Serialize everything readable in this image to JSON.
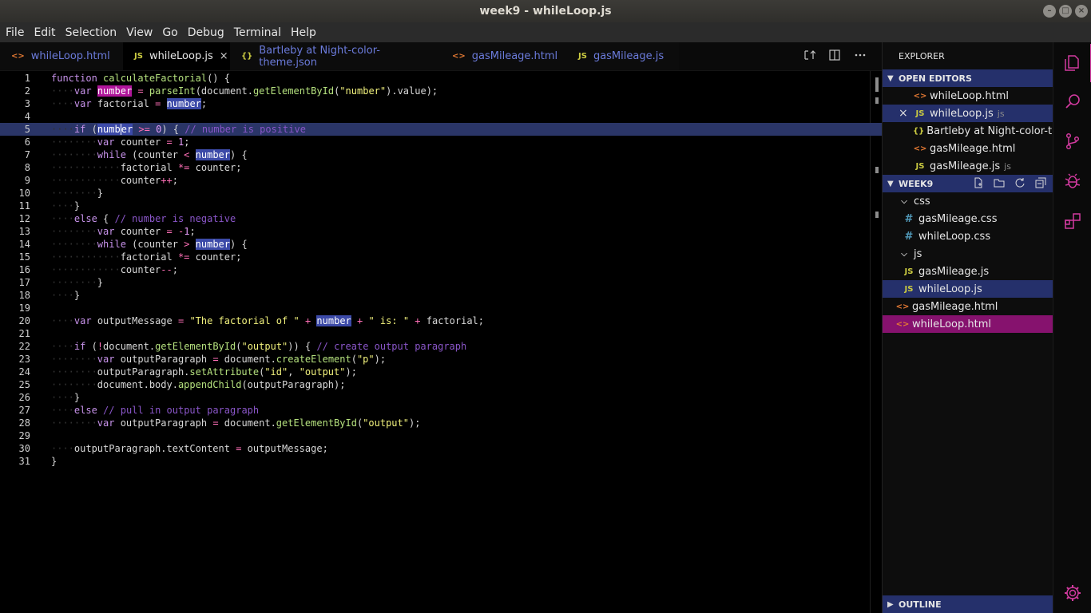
{
  "window": {
    "title": "week9 - whileLoop.js"
  },
  "menu": [
    "File",
    "Edit",
    "Selection",
    "View",
    "Go",
    "Debug",
    "Terminal",
    "Help"
  ],
  "tabs": [
    {
      "label": "whileLoop.html",
      "icon": "<>",
      "active": false
    },
    {
      "label": "whileLoop.js",
      "icon": "JS",
      "active": true
    },
    {
      "label": "Bartleby at Night-color-theme.json",
      "icon": "{}",
      "active": false
    },
    {
      "label": "gasMileage.html",
      "icon": "<>",
      "active": false
    },
    {
      "label": "gasMileage.js",
      "icon": "JS",
      "active": false
    }
  ],
  "tab_close_glyph": "×",
  "explorer": {
    "title": "EXPLORER",
    "open_editors": {
      "label": "OPEN EDITORS",
      "items": [
        {
          "icon": "<>",
          "name": "whileLoop.html",
          "suffix": ""
        },
        {
          "icon": "JS",
          "name": "whileLoop.js",
          "suffix": "js"
        },
        {
          "icon": "{}",
          "name": "Bartleby at Night-color-t...",
          "suffix": ""
        },
        {
          "icon": "<>",
          "name": "gasMileage.html",
          "suffix": ""
        },
        {
          "icon": "JS",
          "name": "gasMileage.js",
          "suffix": "js"
        }
      ]
    },
    "folder": {
      "label": "WEEK9",
      "tree": [
        {
          "type": "folder",
          "name": "css"
        },
        {
          "type": "file",
          "icon": "#",
          "name": "gasMileage.css"
        },
        {
          "type": "file",
          "icon": "#",
          "name": "whileLoop.css"
        },
        {
          "type": "folder",
          "name": "js"
        },
        {
          "type": "file",
          "icon": "JS",
          "name": "gasMileage.js"
        },
        {
          "type": "file",
          "icon": "JS",
          "name": "whileLoop.js"
        },
        {
          "type": "file",
          "icon": "<>",
          "name": "gasMileage.html"
        },
        {
          "type": "file",
          "icon": "<>",
          "name": "whileLoop.html"
        }
      ]
    },
    "outline": "OUTLINE"
  },
  "editor": {
    "language": "javascript",
    "current_line": 5,
    "lines": [
      "function calculateFactorial() {",
      "    var number = parseInt(document.getElementById(\"number\").value);",
      "    var factorial = number;",
      "",
      "    if (number >= 0) { // number is positive",
      "        var counter = 1;",
      "        while (counter < number) {",
      "            factorial *= counter;",
      "            counter++;",
      "        }",
      "    }",
      "    else { // number is negative",
      "        var counter = -1;",
      "        while (counter > number) {",
      "            factorial *= counter;",
      "            counter--;",
      "        }",
      "    }",
      "",
      "    var outputMessage = \"The factorial of \" + number + \" is: \" + factorial;",
      "",
      "    if (!document.getElementById(\"output\")) { // create output paragraph",
      "        var outputParagraph = document.createElement(\"p\");",
      "        outputParagraph.setAttribute(\"id\", \"output\");",
      "        document.body.appendChild(outputParagraph);",
      "    }",
      "    else // pull in output paragraph",
      "        var outputParagraph = document.getElementById(\"output\");",
      "",
      "    outputParagraph.textContent = outputMessage;",
      "}"
    ]
  },
  "colors": {
    "accent": "#d23a9f",
    "selection": "#25306b",
    "focus": "#86126e",
    "keyword": "#c792ea",
    "function": "#b5e17e",
    "string": "#f2f27d",
    "comment": "#8a56c9"
  }
}
